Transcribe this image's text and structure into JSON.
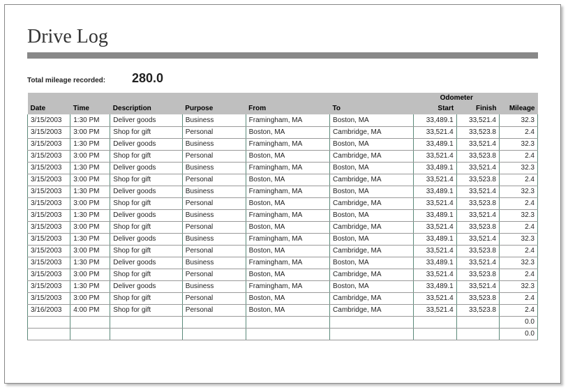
{
  "title": "Drive Log",
  "summary": {
    "label": "Total mileage recorded:",
    "value": "280.0"
  },
  "columns": {
    "date": "Date",
    "time": "Time",
    "description": "Description",
    "purpose": "Purpose",
    "from": "From",
    "to": "To",
    "odometer_group": "Odometer",
    "start": "Start",
    "finish": "Finish",
    "mileage": "Mileage"
  },
  "rows": [
    {
      "date": "3/15/2003",
      "time": "1:30 PM",
      "description": "Deliver goods",
      "purpose": "Business",
      "from": "Framingham, MA",
      "to": "Boston, MA",
      "start": "33,489.1",
      "finish": "33,521.4",
      "mileage": "32.3"
    },
    {
      "date": "3/15/2003",
      "time": "3:00 PM",
      "description": "Shop for gift",
      "purpose": "Personal",
      "from": "Boston, MA",
      "to": "Cambridge, MA",
      "start": "33,521.4",
      "finish": "33,523.8",
      "mileage": "2.4"
    },
    {
      "date": "3/15/2003",
      "time": "1:30 PM",
      "description": "Deliver goods",
      "purpose": "Business",
      "from": "Framingham, MA",
      "to": "Boston, MA",
      "start": "33,489.1",
      "finish": "33,521.4",
      "mileage": "32.3"
    },
    {
      "date": "3/15/2003",
      "time": "3:00 PM",
      "description": "Shop for gift",
      "purpose": "Personal",
      "from": "Boston, MA",
      "to": "Cambridge, MA",
      "start": "33,521.4",
      "finish": "33,523.8",
      "mileage": "2.4"
    },
    {
      "date": "3/15/2003",
      "time": "1:30 PM",
      "description": "Deliver goods",
      "purpose": "Business",
      "from": "Framingham, MA",
      "to": "Boston, MA",
      "start": "33,489.1",
      "finish": "33,521.4",
      "mileage": "32.3"
    },
    {
      "date": "3/15/2003",
      "time": "3:00 PM",
      "description": "Shop for gift",
      "purpose": "Personal",
      "from": "Boston, MA",
      "to": "Cambridge, MA",
      "start": "33,521.4",
      "finish": "33,523.8",
      "mileage": "2.4"
    },
    {
      "date": "3/15/2003",
      "time": "1:30 PM",
      "description": "Deliver goods",
      "purpose": "Business",
      "from": "Framingham, MA",
      "to": "Boston, MA",
      "start": "33,489.1",
      "finish": "33,521.4",
      "mileage": "32.3"
    },
    {
      "date": "3/15/2003",
      "time": "3:00 PM",
      "description": "Shop for gift",
      "purpose": "Personal",
      "from": "Boston, MA",
      "to": "Cambridge, MA",
      "start": "33,521.4",
      "finish": "33,523.8",
      "mileage": "2.4"
    },
    {
      "date": "3/15/2003",
      "time": "1:30 PM",
      "description": "Deliver goods",
      "purpose": "Business",
      "from": "Framingham, MA",
      "to": "Boston, MA",
      "start": "33,489.1",
      "finish": "33,521.4",
      "mileage": "32.3"
    },
    {
      "date": "3/15/2003",
      "time": "3:00 PM",
      "description": "Shop for gift",
      "purpose": "Personal",
      "from": "Boston, MA",
      "to": "Cambridge, MA",
      "start": "33,521.4",
      "finish": "33,523.8",
      "mileage": "2.4"
    },
    {
      "date": "3/15/2003",
      "time": "1:30 PM",
      "description": "Deliver goods",
      "purpose": "Business",
      "from": "Framingham, MA",
      "to": "Boston, MA",
      "start": "33,489.1",
      "finish": "33,521.4",
      "mileage": "32.3"
    },
    {
      "date": "3/15/2003",
      "time": "3:00 PM",
      "description": "Shop for gift",
      "purpose": "Personal",
      "from": "Boston, MA",
      "to": "Cambridge, MA",
      "start": "33,521.4",
      "finish": "33,523.8",
      "mileage": "2.4"
    },
    {
      "date": "3/15/2003",
      "time": "1:30 PM",
      "description": "Deliver goods",
      "purpose": "Business",
      "from": "Framingham, MA",
      "to": "Boston, MA",
      "start": "33,489.1",
      "finish": "33,521.4",
      "mileage": "32.3"
    },
    {
      "date": "3/15/2003",
      "time": "3:00 PM",
      "description": "Shop for gift",
      "purpose": "Personal",
      "from": "Boston, MA",
      "to": "Cambridge, MA",
      "start": "33,521.4",
      "finish": "33,523.8",
      "mileage": "2.4"
    },
    {
      "date": "3/15/2003",
      "time": "1:30 PM",
      "description": "Deliver goods",
      "purpose": "Business",
      "from": "Framingham, MA",
      "to": "Boston, MA",
      "start": "33,489.1",
      "finish": "33,521.4",
      "mileage": "32.3"
    },
    {
      "date": "3/15/2003",
      "time": "3:00 PM",
      "description": "Shop for gift",
      "purpose": "Personal",
      "from": "Boston, MA",
      "to": "Cambridge, MA",
      "start": "33,521.4",
      "finish": "33,523.8",
      "mileage": "2.4"
    },
    {
      "date": "3/16/2003",
      "time": "4:00 PM",
      "description": "Shop for gift",
      "purpose": "Personal",
      "from": "Boston, MA",
      "to": "Cambridge, MA",
      "start": "33,521.4",
      "finish": "33,523.8",
      "mileage": "2.4"
    },
    {
      "date": "",
      "time": "",
      "description": "",
      "purpose": "",
      "from": "",
      "to": "",
      "start": "",
      "finish": "",
      "mileage": "0.0"
    },
    {
      "date": "",
      "time": "",
      "description": "",
      "purpose": "",
      "from": "",
      "to": "",
      "start": "",
      "finish": "",
      "mileage": "0.0"
    }
  ]
}
